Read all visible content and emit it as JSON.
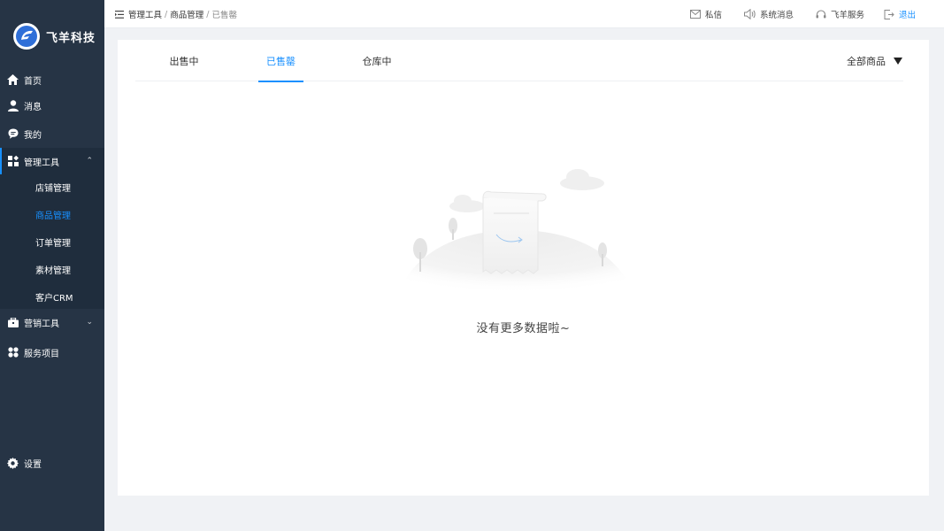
{
  "brand": {
    "name": "飞羊科技"
  },
  "sidebar": {
    "items": [
      {
        "key": "home",
        "label": "首页",
        "icon": "home-icon"
      },
      {
        "key": "messages",
        "label": "消息",
        "icon": "user-icon"
      },
      {
        "key": "mine",
        "label": "我的",
        "icon": "chat-bubble-icon"
      },
      {
        "key": "management",
        "label": "管理工具",
        "icon": "apps-icon"
      },
      {
        "key": "marketing",
        "label": "营销工具",
        "icon": "briefcase-icon"
      },
      {
        "key": "services",
        "label": "服务项目",
        "icon": "grid-icon"
      },
      {
        "key": "settings",
        "label": "设置",
        "icon": "gear-icon"
      }
    ],
    "submenu": [
      {
        "label": "店铺管理"
      },
      {
        "label": "商品管理",
        "active": true
      },
      {
        "label": "订单管理"
      },
      {
        "label": "素材管理"
      },
      {
        "label": "客户CRM"
      }
    ]
  },
  "header": {
    "breadcrumb": [
      "管理工具",
      "商品管理",
      "已售罄"
    ],
    "actions": [
      {
        "label": "私信",
        "icon": "mail-icon"
      },
      {
        "label": "系统消息",
        "icon": "speaker-icon"
      },
      {
        "label": "飞羊服务",
        "icon": "headset-icon"
      },
      {
        "label": "退出",
        "icon": "logout-icon"
      }
    ]
  },
  "main": {
    "tabs": [
      {
        "label": "出售中"
      },
      {
        "label": "已售罄",
        "active": true
      },
      {
        "label": "仓库中"
      }
    ],
    "filter": {
      "label": "全部商品"
    },
    "empty": {
      "text": "没有更多数据啦~"
    }
  },
  "colors": {
    "sidebar_bg": "#263445",
    "accent": "#1890ff",
    "page_bg": "#f0f2f5"
  }
}
